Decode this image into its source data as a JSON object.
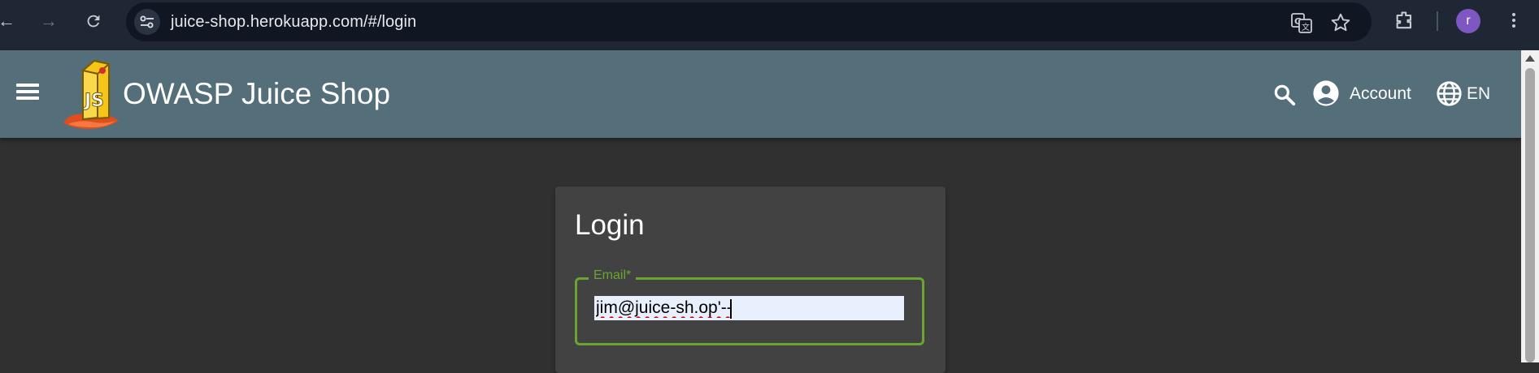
{
  "browser": {
    "url": "juice-shop.herokuapp.com/#/login",
    "profile_initial": "r"
  },
  "toolbar": {
    "app_title": "OWASP Juice Shop",
    "account_label": "Account",
    "language_label": "EN"
  },
  "login": {
    "title": "Login",
    "email_label": "Email*",
    "email_value": "jim@juice-sh.op'--"
  },
  "colors": {
    "toolbar": "#546e7a",
    "background": "#303030",
    "card": "#424242",
    "accent": "#69a530"
  }
}
